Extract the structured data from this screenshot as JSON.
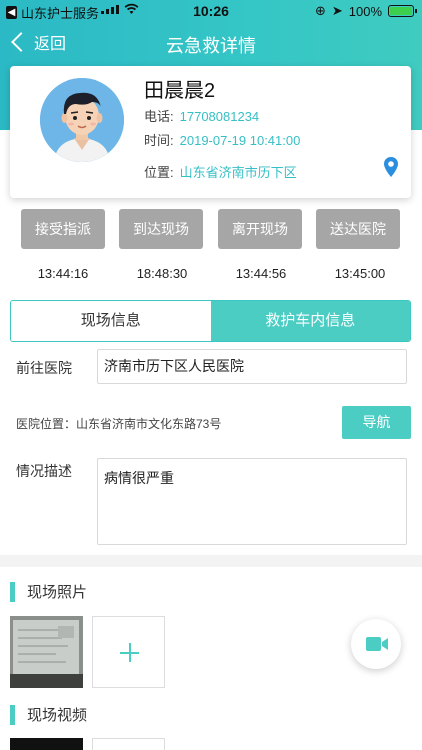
{
  "status_bar": {
    "back_app": "山东护士服务",
    "time": "10:26",
    "battery": "100%"
  },
  "nav": {
    "back_label": "返回",
    "title": "云急救详情"
  },
  "profile": {
    "name": "田晨晨2",
    "phone_label": "电话:",
    "phone": "17708081234",
    "time_label": "时间:",
    "time": "2019-07-19 10:41:00",
    "location_label": "位置:",
    "location": "山东省济南市历下区"
  },
  "steps": [
    {
      "label": "接受指派",
      "time": "13:44:16"
    },
    {
      "label": "到达现场",
      "time": "18:48:30"
    },
    {
      "label": "离开现场",
      "time": "13:44:56"
    },
    {
      "label": "送达医院",
      "time": "13:45:00"
    }
  ],
  "tabs": [
    {
      "label": "现场信息",
      "active": false
    },
    {
      "label": "救护车内信息",
      "active": true
    }
  ],
  "form": {
    "hospital_label": "前往医院",
    "hospital_value": "济南市历下区人民医院",
    "hospital_location": "医院位置：山东省济南市文化东路73号",
    "navigate_button": "导航",
    "description_label": "情况描述",
    "description_value": "病情很严重"
  },
  "sections": {
    "photos_title": "现场照片",
    "videos_title": "现场视频"
  },
  "colors": {
    "accent": "#4ccdc3",
    "header": "#35c6c6",
    "step_button": "#a6a6a6"
  },
  "icons": {
    "back": "chevron-left-icon",
    "location": "location-pin-icon",
    "add": "plus-icon",
    "video": "video-camera-icon"
  }
}
